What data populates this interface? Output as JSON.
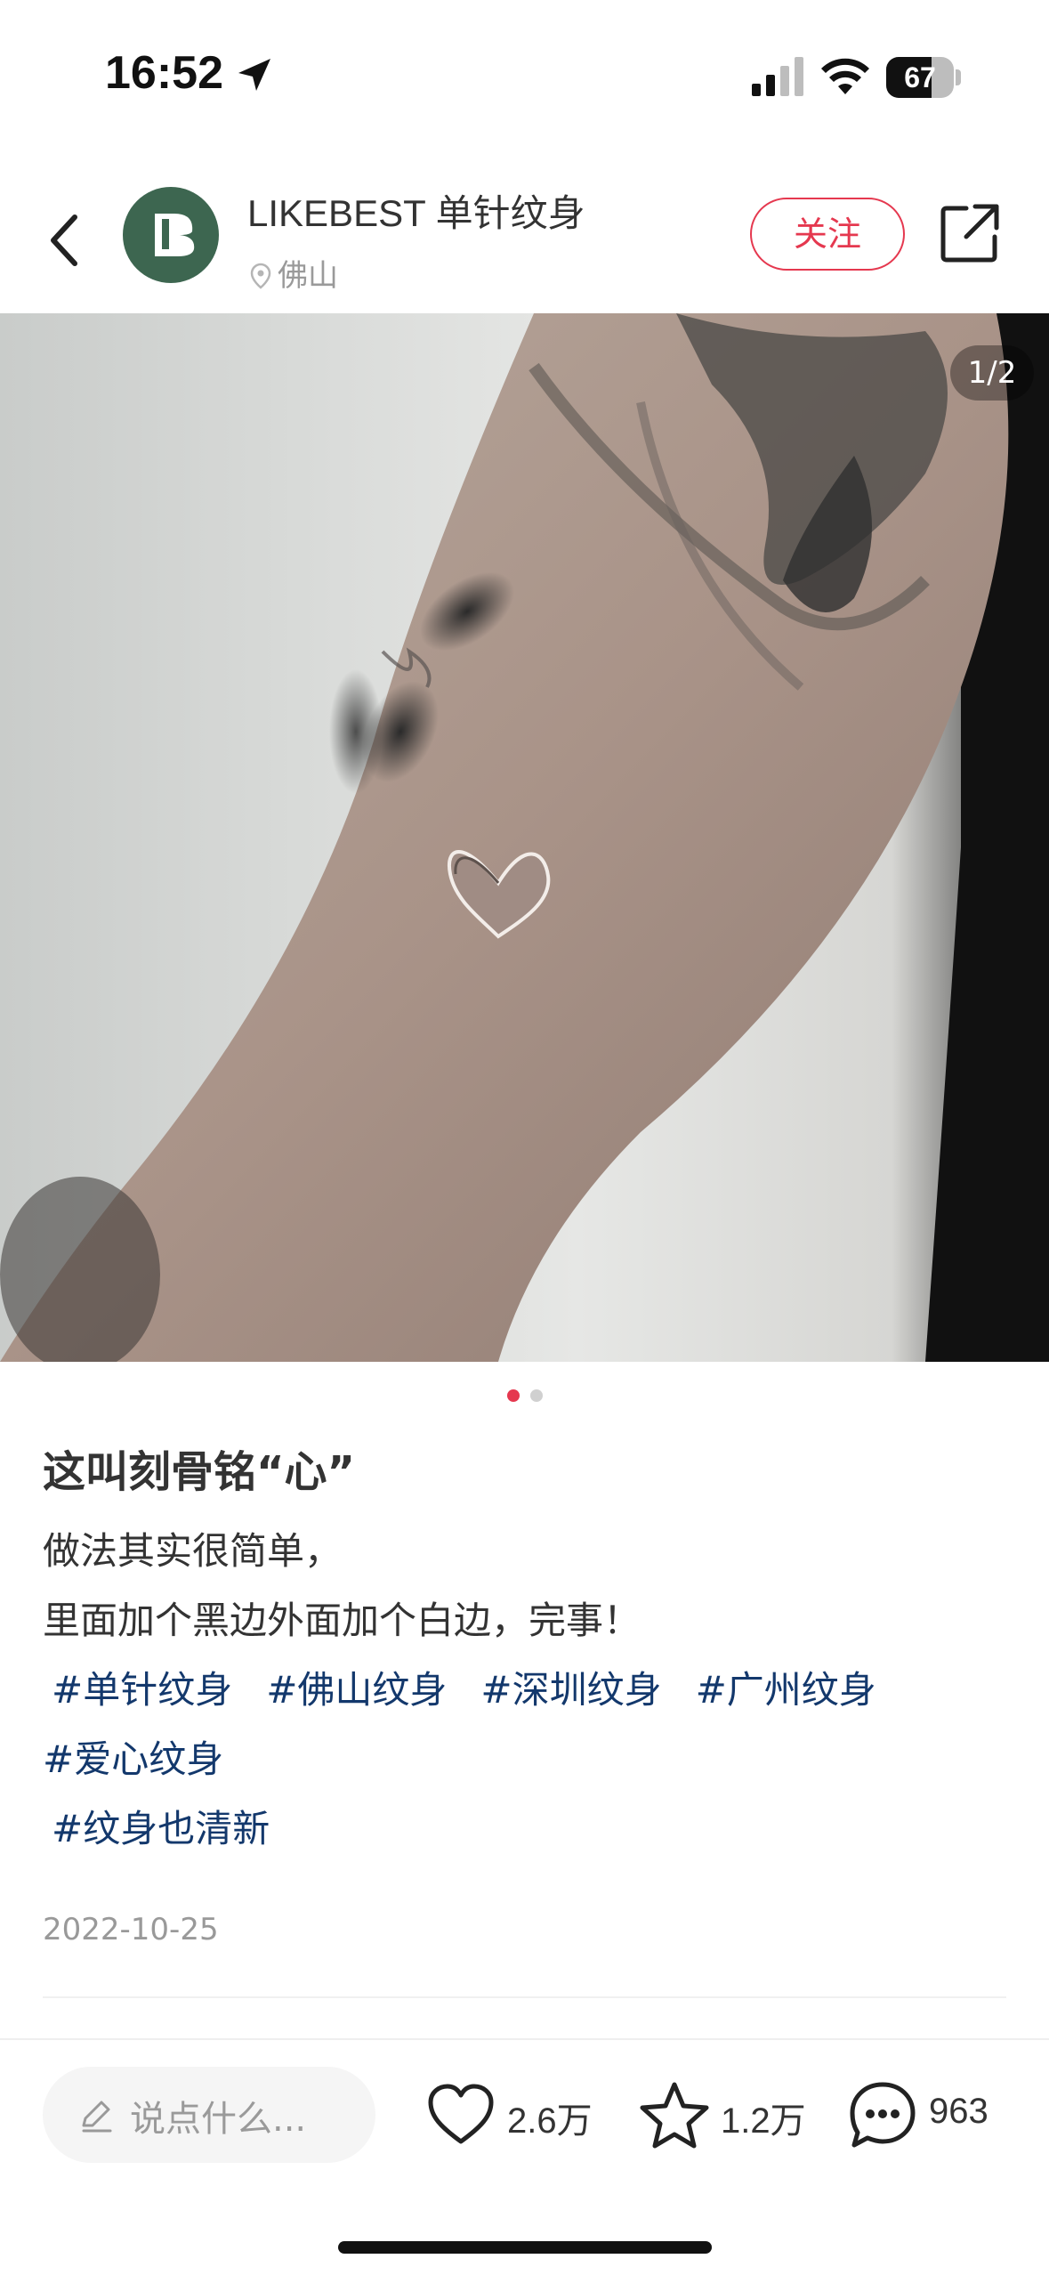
{
  "status_bar": {
    "time": "16:52",
    "battery": "67",
    "battery_level": 0.67
  },
  "header": {
    "author_name": "LIKEBEST 单针纹身",
    "location": "佛山",
    "follow_label": "关注",
    "avatar_color": "#3d6650",
    "accent_color": "#e5384f"
  },
  "image": {
    "counter": "1/2",
    "current_index": 1,
    "total": 2
  },
  "post": {
    "title": "这叫刻骨铭“心”",
    "lines": [
      "做法其实很简单，",
      "里面加个黑边外面加个白边，完事！"
    ],
    "tags_line1": [
      "#单针纹身",
      "#佛山纹身",
      "#深圳纹身",
      "#广州纹身"
    ],
    "tags_line2": [
      "#爱心纹身"
    ],
    "tags_line3": [
      "#纹身也清新"
    ],
    "date": "2022-10-25",
    "tag_color": "#13386c"
  },
  "bottom_bar": {
    "comment_placeholder": "说点什么...",
    "likes": "2.6万",
    "favorites": "1.2万",
    "comments": "963"
  },
  "icons": [
    "location-arrow-icon",
    "signal-icon",
    "wifi-icon",
    "battery-icon",
    "back-icon",
    "location-pin-icon",
    "share-icon",
    "pen-icon",
    "heart-icon",
    "star-icon",
    "comment-icon"
  ]
}
